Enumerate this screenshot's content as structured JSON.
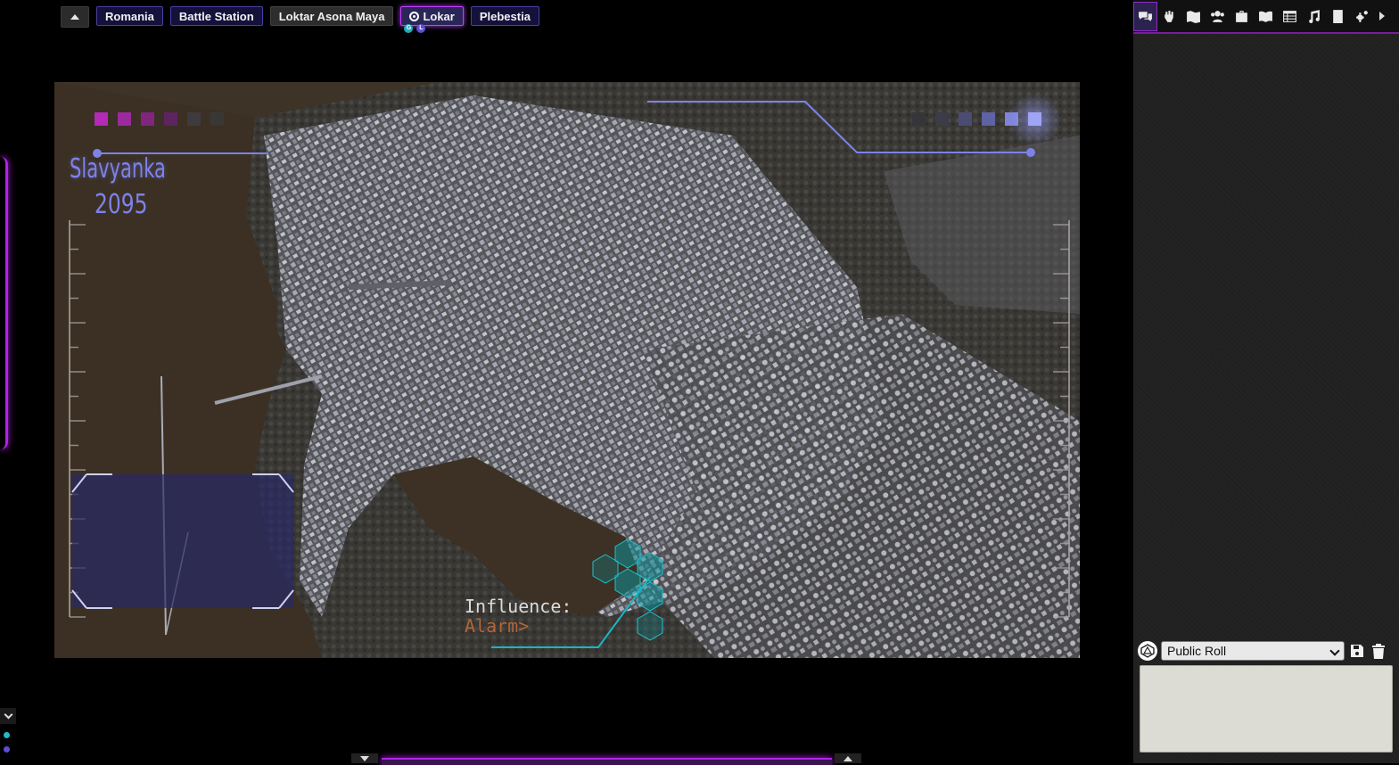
{
  "page_tabs": {
    "collapse_icon": "triangle-up-icon",
    "tabs": [
      {
        "label": "Romania"
      },
      {
        "label": "Battle Station"
      },
      {
        "label": "Loktar Asona Maya"
      },
      {
        "label": "Lokar",
        "icon": "target-icon",
        "badges": [
          "G",
          "L"
        ]
      },
      {
        "label": "Plebestia"
      }
    ]
  },
  "map": {
    "title": "Slavyanka",
    "year": "2095",
    "influence_label": "Influence:",
    "influence_value": "Alarm>"
  },
  "sidebar": {
    "tabs": [
      "chat-icon",
      "hand-icon",
      "map-icon",
      "people-icon",
      "briefcase-icon",
      "book-icon",
      "table-icon",
      "music-icon",
      "journal-icon",
      "settings-icon"
    ],
    "active_tab": "chat-icon",
    "collapse_icon": "triangle-right-icon"
  },
  "chat": {
    "roll_mode": "Public Roll",
    "dice_icon": "d20-icon",
    "save_icon": "save-icon",
    "delete_icon": "trash-icon",
    "input_value": ""
  },
  "colors": {
    "accent": "#b322e6",
    "title_blue": "#7d82ea",
    "hud_teal": "#19b6c6",
    "alarm": "#b3663a"
  }
}
